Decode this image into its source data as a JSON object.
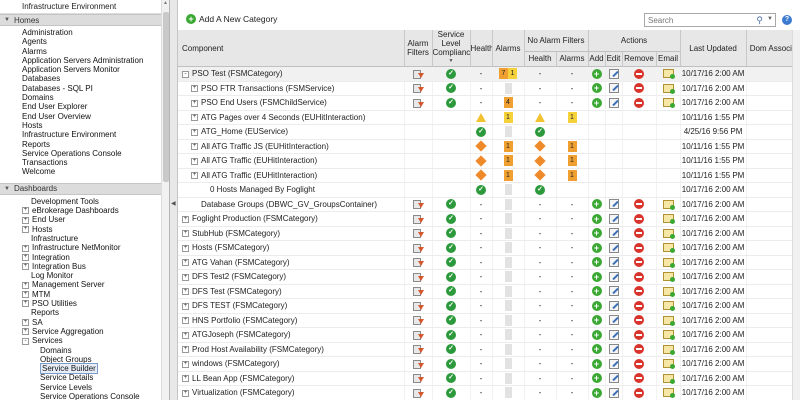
{
  "sidebar": {
    "top_item": "Infrastructure Environment",
    "homes_header": "Homes",
    "homes": [
      "Administration",
      "Agents",
      "Alarms",
      "Application Servers Administration",
      "Application Servers Monitor",
      "Databases",
      "Databases - SQL PI",
      "Domains",
      "End User Explorer",
      "End User Overview",
      "Hosts",
      "Infrastructure Environment",
      "Reports",
      "Service Operations Console",
      "Transactions",
      "Welcome"
    ],
    "dashboards_header": "Dashboards",
    "dashboards": [
      {
        "label": "Development Tools",
        "level": 0,
        "expander": ""
      },
      {
        "label": "eBrokerage Dashboards",
        "level": 0,
        "expander": "+"
      },
      {
        "label": "End User",
        "level": 0,
        "expander": "+"
      },
      {
        "label": "Hosts",
        "level": 0,
        "expander": "+"
      },
      {
        "label": "Infrastructure",
        "level": 0,
        "expander": ""
      },
      {
        "label": "Infrastructure NetMonitor",
        "level": 0,
        "expander": "+"
      },
      {
        "label": "Integration",
        "level": 0,
        "expander": "+"
      },
      {
        "label": "Integration Bus",
        "level": 0,
        "expander": "+"
      },
      {
        "label": "Log Monitor",
        "level": 0,
        "expander": ""
      },
      {
        "label": "Management Server",
        "level": 0,
        "expander": "+"
      },
      {
        "label": "MTM",
        "level": 0,
        "expander": "+"
      },
      {
        "label": "PSO Utilities",
        "level": 0,
        "expander": "+"
      },
      {
        "label": "Reports",
        "level": 0,
        "expander": ""
      },
      {
        "label": "SA",
        "level": 0,
        "expander": "+"
      },
      {
        "label": "Service Aggregation",
        "level": 0,
        "expander": "+"
      },
      {
        "label": "Services",
        "level": 0,
        "expander": "-"
      },
      {
        "label": "Domains",
        "level": 1,
        "expander": ""
      },
      {
        "label": "Object Groups",
        "level": 1,
        "expander": ""
      },
      {
        "label": "Service Builder",
        "level": 1,
        "expander": "",
        "selected": true
      },
      {
        "label": "Service Details",
        "level": 1,
        "expander": ""
      },
      {
        "label": "Service Levels",
        "level": 1,
        "expander": ""
      },
      {
        "label": "Service Operations Console",
        "level": 1,
        "expander": ""
      }
    ]
  },
  "toolbar": {
    "add_label": "Add A New Category",
    "search_placeholder": "Search"
  },
  "columns": {
    "component": "Component",
    "alarm_filters": "Alarm Filters",
    "slc": "Service Level Compliance",
    "health": "Health",
    "alarms": "Alarms",
    "no_alarm_filters": "No Alarm Filters",
    "naf_health": "Health",
    "naf_alarms": "Alarms",
    "actions": "Actions",
    "add": "Add",
    "edit": "Edit",
    "remove": "Remove",
    "email": "Email",
    "last_updated": "Last Updated",
    "dom_assoc": "Dom Associa"
  },
  "rows": [
    {
      "indent": 0,
      "exp": "-",
      "name": "PSO Test (FSMCategory)",
      "filter": true,
      "slc": "check",
      "health": "-",
      "a1": "7",
      "a2": "1",
      "nh": "-",
      "na": "-",
      "actions": true,
      "updated": "10/17/16 2:00 AM",
      "sel": true
    },
    {
      "indent": 1,
      "exp": "+",
      "name": "PSO FTR Transactions (FSMService)",
      "filter": true,
      "slc": "check",
      "health": "-",
      "a1": "",
      "a2": "",
      "nh": "-",
      "na": "-",
      "actions": true,
      "updated": "10/17/16 2:00 AM"
    },
    {
      "indent": 1,
      "exp": "+",
      "name": "PSO End Users (FSMChildService)",
      "filter": true,
      "slc": "check",
      "health": "-",
      "a1": "4",
      "a2": "",
      "nh": "-",
      "na": "-",
      "actions": true,
      "updated": "10/17/16 2:00 AM"
    },
    {
      "indent": 1,
      "exp": "+",
      "name": "ATG Pages over 4 Seconds (EUHitInteraction)",
      "filter": false,
      "slc": "",
      "health": "warn",
      "a1": "",
      "a2": "1",
      "nh": "warn",
      "na": "1",
      "actions": false,
      "updated": "10/11/16 1:55 PM"
    },
    {
      "indent": 1,
      "exp": "+",
      "name": "ATG_Home (EUService)",
      "filter": false,
      "slc": "",
      "health": "check",
      "a1": "",
      "a2": "",
      "nh": "check",
      "na": "",
      "actions": false,
      "updated": "4/25/16 9:56 PM"
    },
    {
      "indent": 1,
      "exp": "+",
      "name": "All ATG Traffic JS (EUHitInteraction)",
      "filter": false,
      "slc": "",
      "health": "diamond",
      "a1": "1",
      "a2": "",
      "nh": "diamond",
      "na": "1",
      "actions": false,
      "updated": "10/11/16 1:55 PM"
    },
    {
      "indent": 1,
      "exp": "+",
      "name": "All ATG Traffic (EUHitInteraction)",
      "filter": false,
      "slc": "",
      "health": "diamond",
      "a1": "1",
      "a2": "",
      "nh": "diamond",
      "na": "1",
      "actions": false,
      "updated": "10/11/16 1:55 PM"
    },
    {
      "indent": 1,
      "exp": "+",
      "name": "All ATG Traffic (EUHitInteraction)",
      "filter": false,
      "slc": "",
      "health": "diamond",
      "a1": "1",
      "a2": "",
      "nh": "diamond",
      "na": "1",
      "actions": false,
      "updated": "10/11/16 1:55 PM"
    },
    {
      "indent": 2,
      "exp": "",
      "name": "0 Hosts Managed By Foglight",
      "filter": false,
      "slc": "",
      "health": "check",
      "a1": "",
      "a2": "",
      "nh": "check",
      "na": "",
      "actions": false,
      "updated": "10/17/16 2:00 AM"
    },
    {
      "indent": 1,
      "exp": "",
      "name": "Database Groups (DBWC_GV_GroupsContainer)",
      "filter": true,
      "slc": "check",
      "health": "-",
      "a1": "",
      "a2": "",
      "nh": "-",
      "na": "-",
      "actions": true,
      "updated": "10/17/16 2:00 AM"
    },
    {
      "indent": 0,
      "exp": "+",
      "name": "Foglight Production (FSMCategory)",
      "filter": true,
      "slc": "check",
      "health": "-",
      "a1": "",
      "a2": "",
      "nh": "-",
      "na": "-",
      "actions": true,
      "updated": "10/17/16 2:00 AM"
    },
    {
      "indent": 0,
      "exp": "+",
      "name": "StubHub (FSMCategory)",
      "filter": true,
      "slc": "check",
      "health": "-",
      "a1": "",
      "a2": "",
      "nh": "-",
      "na": "-",
      "actions": true,
      "updated": "10/17/16 2:00 AM"
    },
    {
      "indent": 0,
      "exp": "+",
      "name": "Hosts (FSMCategory)",
      "filter": true,
      "slc": "check",
      "health": "-",
      "a1": "",
      "a2": "",
      "nh": "-",
      "na": "-",
      "actions": true,
      "updated": "10/17/16 2:00 AM"
    },
    {
      "indent": 0,
      "exp": "+",
      "name": "ATG Vahan (FSMCategory)",
      "filter": true,
      "slc": "check",
      "health": "-",
      "a1": "",
      "a2": "",
      "nh": "-",
      "na": "-",
      "actions": true,
      "updated": "10/17/16 2:00 AM"
    },
    {
      "indent": 0,
      "exp": "+",
      "name": "DFS Test2 (FSMCategory)",
      "filter": true,
      "slc": "check",
      "health": "-",
      "a1": "",
      "a2": "",
      "nh": "-",
      "na": "-",
      "actions": true,
      "updated": "10/17/16 2:00 AM"
    },
    {
      "indent": 0,
      "exp": "+",
      "name": "DFS Test (FSMCategory)",
      "filter": true,
      "slc": "check",
      "health": "-",
      "a1": "",
      "a2": "",
      "nh": "-",
      "na": "-",
      "actions": true,
      "updated": "10/17/16 2:00 AM"
    },
    {
      "indent": 0,
      "exp": "+",
      "name": "DFS TEST (FSMCategory)",
      "filter": true,
      "slc": "check",
      "health": "-",
      "a1": "",
      "a2": "",
      "nh": "-",
      "na": "-",
      "actions": true,
      "updated": "10/17/16 2:00 AM"
    },
    {
      "indent": 0,
      "exp": "+",
      "name": "HNS Portfolio (FSMCategory)",
      "filter": true,
      "slc": "check",
      "health": "-",
      "a1": "",
      "a2": "",
      "nh": "-",
      "na": "-",
      "actions": true,
      "updated": "10/17/16 2:00 AM"
    },
    {
      "indent": 0,
      "exp": "+",
      "name": "ATGJoseph (FSMCategory)",
      "filter": true,
      "slc": "check",
      "health": "-",
      "a1": "",
      "a2": "",
      "nh": "-",
      "na": "-",
      "actions": true,
      "updated": "10/17/16 2:00 AM"
    },
    {
      "indent": 0,
      "exp": "+",
      "name": "Prod Host Availability (FSMCategory)",
      "filter": true,
      "slc": "check",
      "health": "-",
      "a1": "",
      "a2": "",
      "nh": "-",
      "na": "-",
      "actions": true,
      "updated": "10/17/16 2:00 AM"
    },
    {
      "indent": 0,
      "exp": "+",
      "name": "windows (FSMCategory)",
      "filter": true,
      "slc": "check",
      "health": "-",
      "a1": "",
      "a2": "",
      "nh": "-",
      "na": "-",
      "actions": true,
      "updated": "10/17/16 2:00 AM"
    },
    {
      "indent": 0,
      "exp": "+",
      "name": "LL Bean App (FSMCategory)",
      "filter": true,
      "slc": "check",
      "health": "-",
      "a1": "",
      "a2": "",
      "nh": "-",
      "na": "-",
      "actions": true,
      "updated": "10/17/16 2:00 AM"
    },
    {
      "indent": 0,
      "exp": "+",
      "name": "Virtualization (FSMCategory)",
      "filter": true,
      "slc": "check",
      "health": "-",
      "a1": "",
      "a2": "",
      "nh": "-",
      "na": "-",
      "actions": true,
      "updated": "10/17/16 2:00 AM"
    }
  ]
}
